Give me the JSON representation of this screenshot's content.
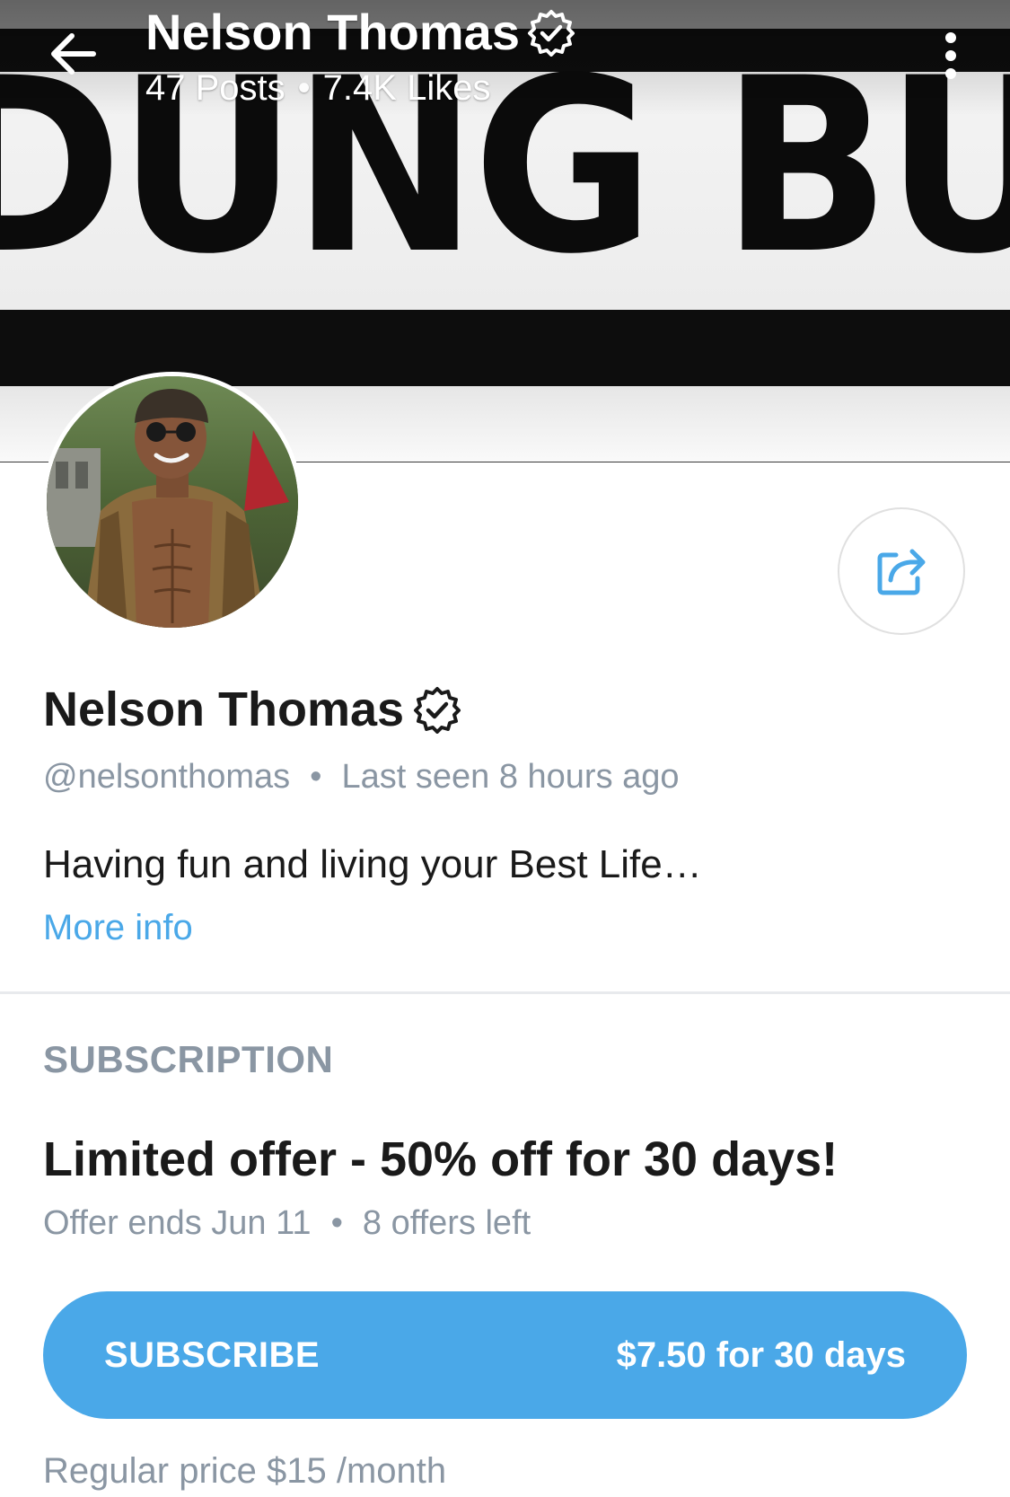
{
  "header": {
    "name": "Nelson Thomas",
    "posts": "47 Posts",
    "likes": "7.4K Likes",
    "separator": "•",
    "back_icon": "arrow-left-icon",
    "more_icon": "vertical-dots-icon"
  },
  "cover": {
    "text": "DUNG BUCK"
  },
  "profile": {
    "name": "Nelson Thomas",
    "verified_icon": "verified-badge-icon",
    "handle": "@nelsonthomas",
    "separator": "•",
    "last_seen": "Last seen 8 hours ago",
    "bio": "Having fun and living your Best Life…",
    "more_info": "More info",
    "share_icon": "share-icon"
  },
  "subscription": {
    "heading": "SUBSCRIPTION",
    "offer_title": "Limited offer - 50% off for 30 days!",
    "offer_ends": "Offer ends Jun 11",
    "separator": "•",
    "offers_left": "8 offers left",
    "button_label": "SUBSCRIBE",
    "button_price": "$7.50 for 30 days",
    "regular_price": "Regular price $15 /month"
  },
  "colors": {
    "accent": "#4aa8e8",
    "muted_text": "#8a96a3",
    "primary_text": "#1a1a1a"
  }
}
